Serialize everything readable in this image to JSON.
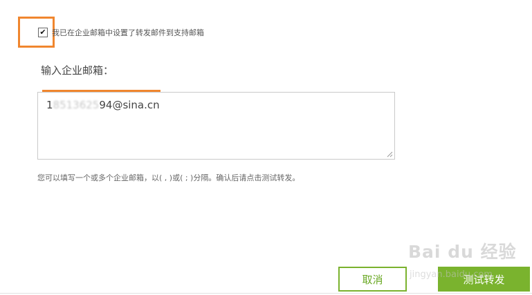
{
  "forwarding": {
    "checkbox_checked": true,
    "checkbox_mark": "✔",
    "checkbox_label": "我已在企业邮箱中设置了转发邮件到支持邮箱"
  },
  "email_input": {
    "label": "输入企业邮箱：",
    "value_visible_prefix": "1",
    "value_obscured": "8513625",
    "value_visible_suffix": "94@sina.cn"
  },
  "hint_text": "您可以填写一个或多个企业邮箱，以( , )或( ; )分隔。确认后请点击测试转发。",
  "buttons": {
    "cancel_label": "取消",
    "test_label": "测试转发"
  },
  "watermark": {
    "brand": "Bai du 经验",
    "url": "jingyan.baidu.com"
  },
  "colors": {
    "accent_green": "#7ab32e",
    "highlight_orange": "#f0862e"
  }
}
